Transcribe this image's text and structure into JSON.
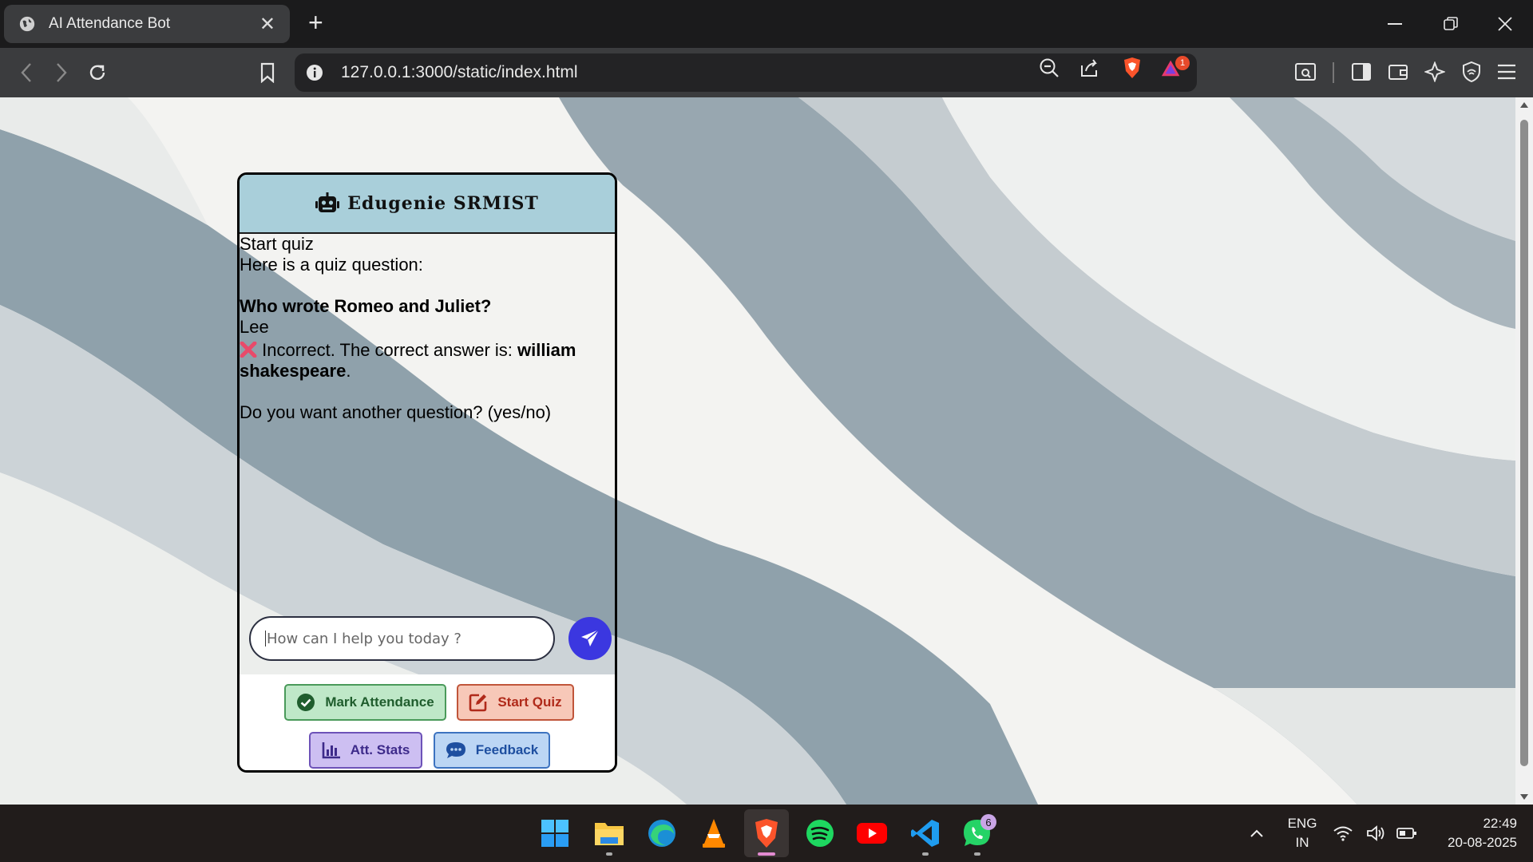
{
  "browser": {
    "tab_title": "AI Attendance Bot",
    "url": "127.0.0.1:3000/static/index.html",
    "alert_badge": "1"
  },
  "chat": {
    "header_title": "Edugenie SRMIST",
    "messages": {
      "line1": "Start quiz",
      "line2": "Here is a quiz question:",
      "question": "Who wrote Romeo and Juliet?",
      "answer": "Lee",
      "incorrect_prefix": " Incorrect. The correct answer is: ",
      "correct_answer": "william shakespeare",
      "incorrect_suffix": ".",
      "followup": "Do you want another question? (yes/no)"
    },
    "input_placeholder": "How can I help you today ?",
    "buttons": {
      "mark_attendance": "Mark Attendance",
      "start_quiz": "Start Quiz",
      "att_stats": "Att. Stats",
      "feedback": "Feedback"
    }
  },
  "taskbar": {
    "language_line1": "ENG",
    "language_line2": "IN",
    "time": "22:49",
    "date": "20-08-2025",
    "whatsapp_badge": "6"
  },
  "colors": {
    "header_bg": "#a9cfda",
    "send_button": "#3b37e0",
    "incorrect_icon": "#e84a6a"
  }
}
